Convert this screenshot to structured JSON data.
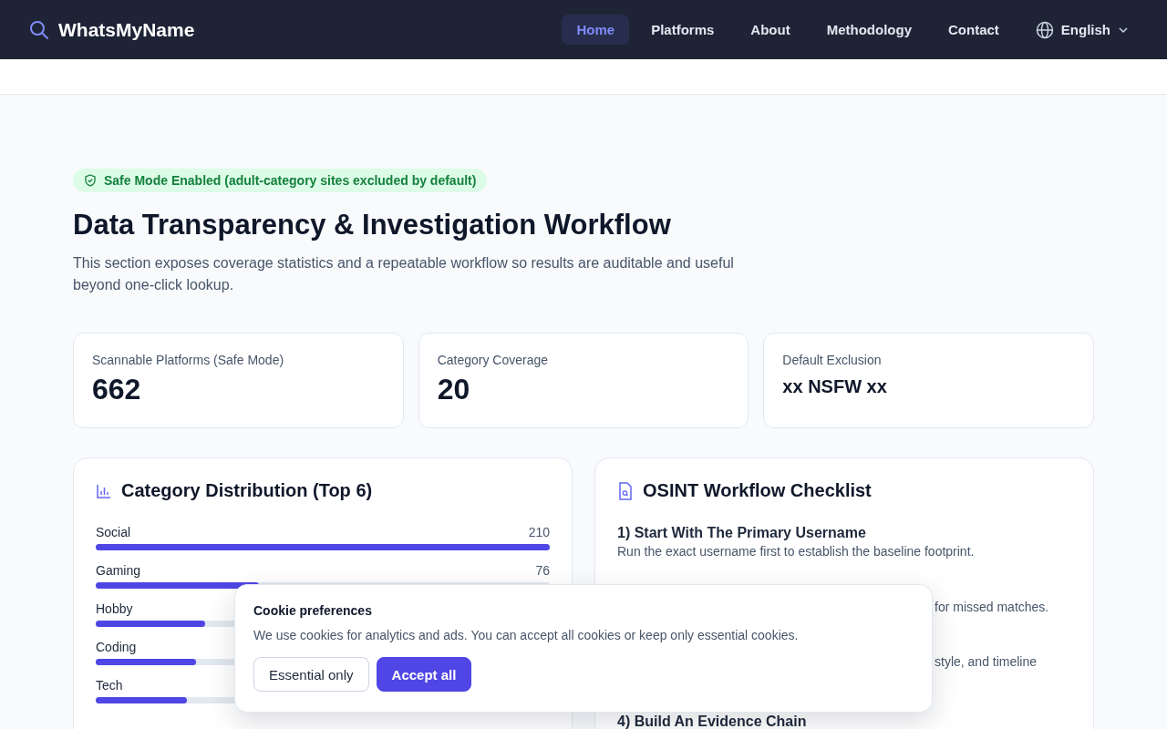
{
  "nav": {
    "brand": "WhatsMyName",
    "links": [
      {
        "label": "Home",
        "selected": true
      },
      {
        "label": "Platforms",
        "selected": false
      },
      {
        "label": "About",
        "selected": false
      },
      {
        "label": "Methodology",
        "selected": false
      },
      {
        "label": "Contact",
        "selected": false
      }
    ],
    "language": "English"
  },
  "badge": "Safe Mode Enabled (adult-category sites excluded by default)",
  "title": "Data Transparency & Investigation Workflow",
  "intro": "This section exposes coverage statistics and a repeatable workflow so results are auditable and useful beyond one-click lookup.",
  "stats": [
    {
      "label": "Scannable Platforms (Safe Mode)",
      "value": "662",
      "kind": "number"
    },
    {
      "label": "Category Coverage",
      "value": "20",
      "kind": "number"
    },
    {
      "label": "Default Exclusion",
      "value": "xx NSFW xx",
      "kind": "text"
    }
  ],
  "distribution": {
    "title": "Category Distribution (Top 6)",
    "items": [
      {
        "name": "Social",
        "count": "210",
        "level": 1.0
      },
      {
        "name": "Gaming",
        "count": "76",
        "level": 0.36
      },
      {
        "name": "Hobby",
        "level": 0.24
      },
      {
        "name": "Coding",
        "level": 0.22
      },
      {
        "name": "Tech",
        "level": 0.2
      }
    ]
  },
  "checklist": {
    "title": "OSINT Workflow Checklist",
    "steps": [
      {
        "kind": "full",
        "title": "1) Start With The Primary Username",
        "description": "Run the exact username first to establish the baseline footprint."
      },
      {
        "kind": "covered",
        "description": "for missed matches."
      },
      {
        "kind": "covered",
        "description": "style, and timeline"
      },
      {
        "kind": "full",
        "title": "4) Build An Evidence Chain"
      }
    ]
  },
  "cookie": {
    "title": "Cookie preferences",
    "text": "We use cookies for analytics and ads. You can accept all cookies or keep only essential cookies.",
    "buttons": [
      {
        "label": "Essential only",
        "kind": "secondary"
      },
      {
        "label": "Accept all",
        "kind": "primary"
      }
    ]
  }
}
